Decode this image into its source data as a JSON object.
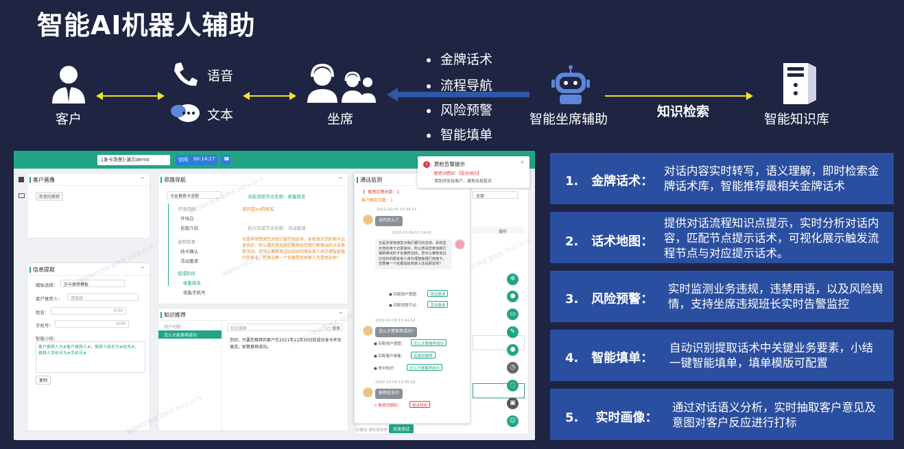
{
  "title": "智能AI机器人辅助",
  "flow": {
    "customer": "客户",
    "voice": "语音",
    "text": "文本",
    "agent": "坐席",
    "bullets": [
      "金牌话术",
      "流程导航",
      "风险预警",
      "智能填单"
    ],
    "assistant": "智能坐席辅助",
    "knowledge_label": "知识检索",
    "knowledge_base": "智能知识库"
  },
  "colors": {
    "background": "#1e2442",
    "accent_yellow": "#f5e12a",
    "feature_box": "#2b4fa0",
    "app_green": "#22a585"
  },
  "screenshot": {
    "topbar": {
      "scene_input": "[发卡场景]-演示demo",
      "status_btn": "空闲",
      "timer": "00:14:17"
    },
    "alert": {
      "title": "质检告警提示",
      "line1": "敏感词感知：【投诉倾向】",
      "line2": "请及时安抚客户，避免出现投诉"
    },
    "customer_portrait": {
      "header": "客户画像",
      "tag": "有意向推荐"
    },
    "thinking_nav": {
      "header": "思路导航",
      "select": "卡友推荐卡流程",
      "steps": [
        "开场问候",
        "开场白",
        "自我介绍",
        "说明来意",
        "持卡确认",
        "活动邀请",
        "促成阶段",
        "收集姓名",
        "收集手机号"
      ],
      "current_node": "当前流程节点名称：收集姓名",
      "ask_name": "请问您xx的姓名",
      "done_node": "执行完成节点名称：活动邀请",
      "script": "也是非常感谢您对我们银行的支持，系统显示您的用卡记录良好，所以邀您参加我们推荐给您我们新推出的卡友推荐活动，您可以推荐身边比较好的朋友家人来办理智能银行信用卡，您身边第一个名额是给到家人还是朋友呢？"
    },
    "info_extract": {
      "header": "信息提取",
      "template_label": "模板选择：",
      "template_value": "办卡推荐模板",
      "referrer_label": "客户推荐人：",
      "referrer_placeholder": "请选择",
      "name_label": "姓名：",
      "name_count": "0/30",
      "phone_label": "手机号：",
      "phone_count": "0/30",
      "summary_label": "智能小结：",
      "summary": "客户推荐人为#客户推荐人#，推荐人姓名为#姓名#，推荐人手机号为#手机号#",
      "copy_btn": "复制"
    },
    "knowledge": {
      "header": "知识推荐",
      "user_question": "用户问题：",
      "item": "怎么才能推荐成功",
      "search_placeholder": "知识搜索",
      "search_btn": "搜索",
      "answer": "您好，只要您推荐的客户在2021年11月30日前成功发卡并且激活，即算推荐成功。"
    },
    "call_monitor": {
      "header": "通话监测",
      "sensitive": "❗ 敏感告警总数：",
      "sensitive_count": "1",
      "violation": "客户触犯次数：",
      "violation_count": "1",
      "t1": "2022-10-09 13:34:37",
      "msg1": "对的您么了",
      "t2": "2022-10-09 13:34:42",
      "msg2": "也是非常感谢您对我们银行的支持，系统显示您的用卡记录良好，所以邀请您参加我们最新推出的卡友推荐活动，您可以推荐身边比较好的朋友家人来办理智能银行信用卡。您要第一个名额是给到家人还是朋友呢？",
      "match_user": "匹配用户意图：",
      "match_user_tag": "活动邀请",
      "match_flow": "匹配流程节点：",
      "match_flow_tag": "活动邀请",
      "t3": "2022-10-09 13:34:52",
      "msg3": "怎么才算推荐成功?",
      "match_user_tag2": "怎么才算推荐成功",
      "match_portrait": "匹配客户画像：",
      "portrait_tag": "有意向推荐",
      "hit_knowledge": "命中知识：",
      "knowledge_tag": "怎么才算推荐成功",
      "t4": "2022-10-09 13:35:02",
      "msg4": "推荐投诉中",
      "sensitive_perceive": "敏感词感知：",
      "complaint_tag": "投诉倾向"
    },
    "right_panel": {
      "filter": "全部",
      "ops": "操作",
      "send_btn": "坊发测试",
      "hint": "存联动 请坊员协作"
    },
    "watermark": "智能BOT测试 宣传杰 2022-10-9"
  },
  "features": [
    {
      "num": "1.",
      "name": "金牌话术：",
      "desc": "对话内容实时转写，语义理解，即时检索金牌话术库，智能推荐最相关金牌话术"
    },
    {
      "num": "2.",
      "name": "话术地图：",
      "desc": "提供对话流程知识点提示，实时分析对话内容，匹配节点提示话术，可视化展示触发流程节点与对应提示话术。"
    },
    {
      "num": "3.",
      "name": "风险预警：",
      "desc": "实时监测业务违规，违禁用语，以及风险舆情，支持坐席违规班长实时告警监控"
    },
    {
      "num": "4.",
      "name": "智能填单：",
      "desc": "自动识别提取话术中关键业务要素，小结一键智能填单，填单模版可配置"
    },
    {
      "num": "5.",
      "name": "实时画像：",
      "desc": "通过对话语义分析，实时抽取客户意见及意图对客户反应进行打标"
    }
  ]
}
